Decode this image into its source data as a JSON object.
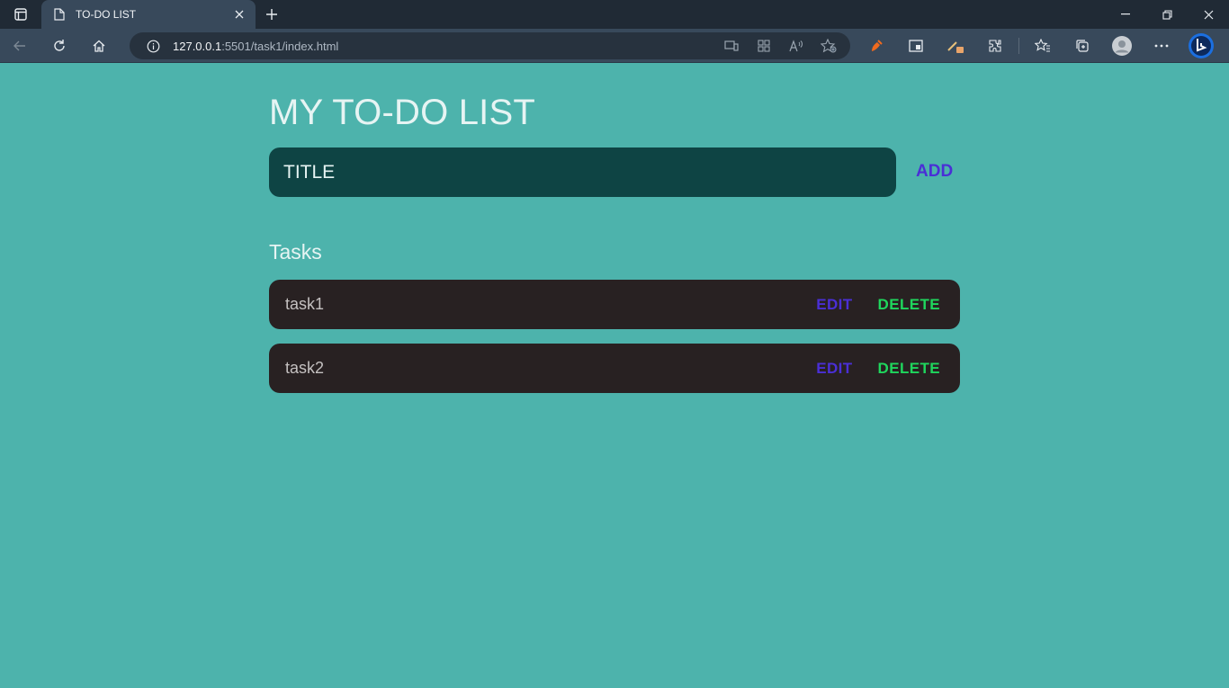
{
  "browser": {
    "tab_title": "TO-DO LIST",
    "url_host": "127.0.0.1",
    "url_rest": ":5501/task1/index.html"
  },
  "app": {
    "title": "MY TO-DO LIST",
    "input_placeholder": "TITLE",
    "add_label": "ADD",
    "tasks_heading": "Tasks",
    "edit_label": "EDIT",
    "delete_label": "DELETE",
    "tasks": [
      {
        "text": "task1"
      },
      {
        "text": "task2"
      }
    ]
  },
  "colors": {
    "page_bg": "#4db3ac",
    "input_bg": "#0e4444",
    "task_bg": "#282122",
    "edit": "#4a2fd6",
    "delete": "#1fd65d"
  }
}
